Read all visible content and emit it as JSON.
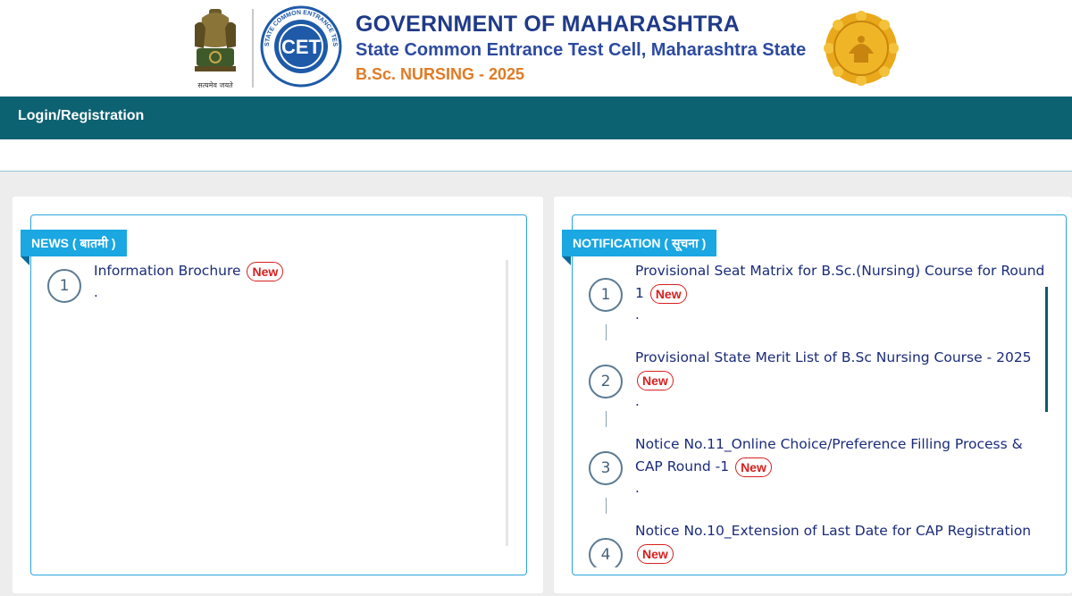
{
  "header": {
    "emblem_caption": "सत्यमेव जयते",
    "cet_logo_text": "CET",
    "cet_logo_ring": "STATE COMMON ENTRANCE TEST CELL · MAHARASHTRA",
    "gov_title": "GOVERNMENT OF MAHARASHTRA",
    "cell_title": "State Common Entrance Test Cell, Maharashtra State",
    "course_title": "B.Sc. NURSING - 2025"
  },
  "nav": {
    "login_label": "Login/Registration"
  },
  "news": {
    "heading": "NEWS ( बातमी )",
    "items": [
      {
        "num": "1",
        "title": "Information Brochure",
        "badge": "New",
        "detail": "."
      }
    ]
  },
  "notification": {
    "heading": "NOTIFICATION ( सूचना )",
    "items": [
      {
        "num": "1",
        "title": "Provisional Seat Matrix for B.Sc.(Nursing) Course for Round 1",
        "badge": "New",
        "detail": "."
      },
      {
        "num": "2",
        "title": "Provisional State Merit List of B.Sc Nursing Course - 2025",
        "badge": "New",
        "detail": "."
      },
      {
        "num": "3",
        "title": "Notice No.11_Online Choice/Preference Filling Process & CAP Round -1",
        "badge": "New",
        "detail": "."
      },
      {
        "num": "4",
        "title": "Notice No.10_Extension of Last Date for CAP Registration",
        "badge": "New",
        "detail": ""
      }
    ]
  },
  "colors": {
    "navbar": "#0d6272",
    "ribbon": "#1aa7e2",
    "gov_title": "#1f3a88",
    "course_title": "#e07b24",
    "new_badge": "#d81f1f"
  },
  "icons": {
    "emblem": "national-emblem-icon",
    "cet": "cet-logo-icon",
    "seal": "maharashtra-seal-icon"
  }
}
